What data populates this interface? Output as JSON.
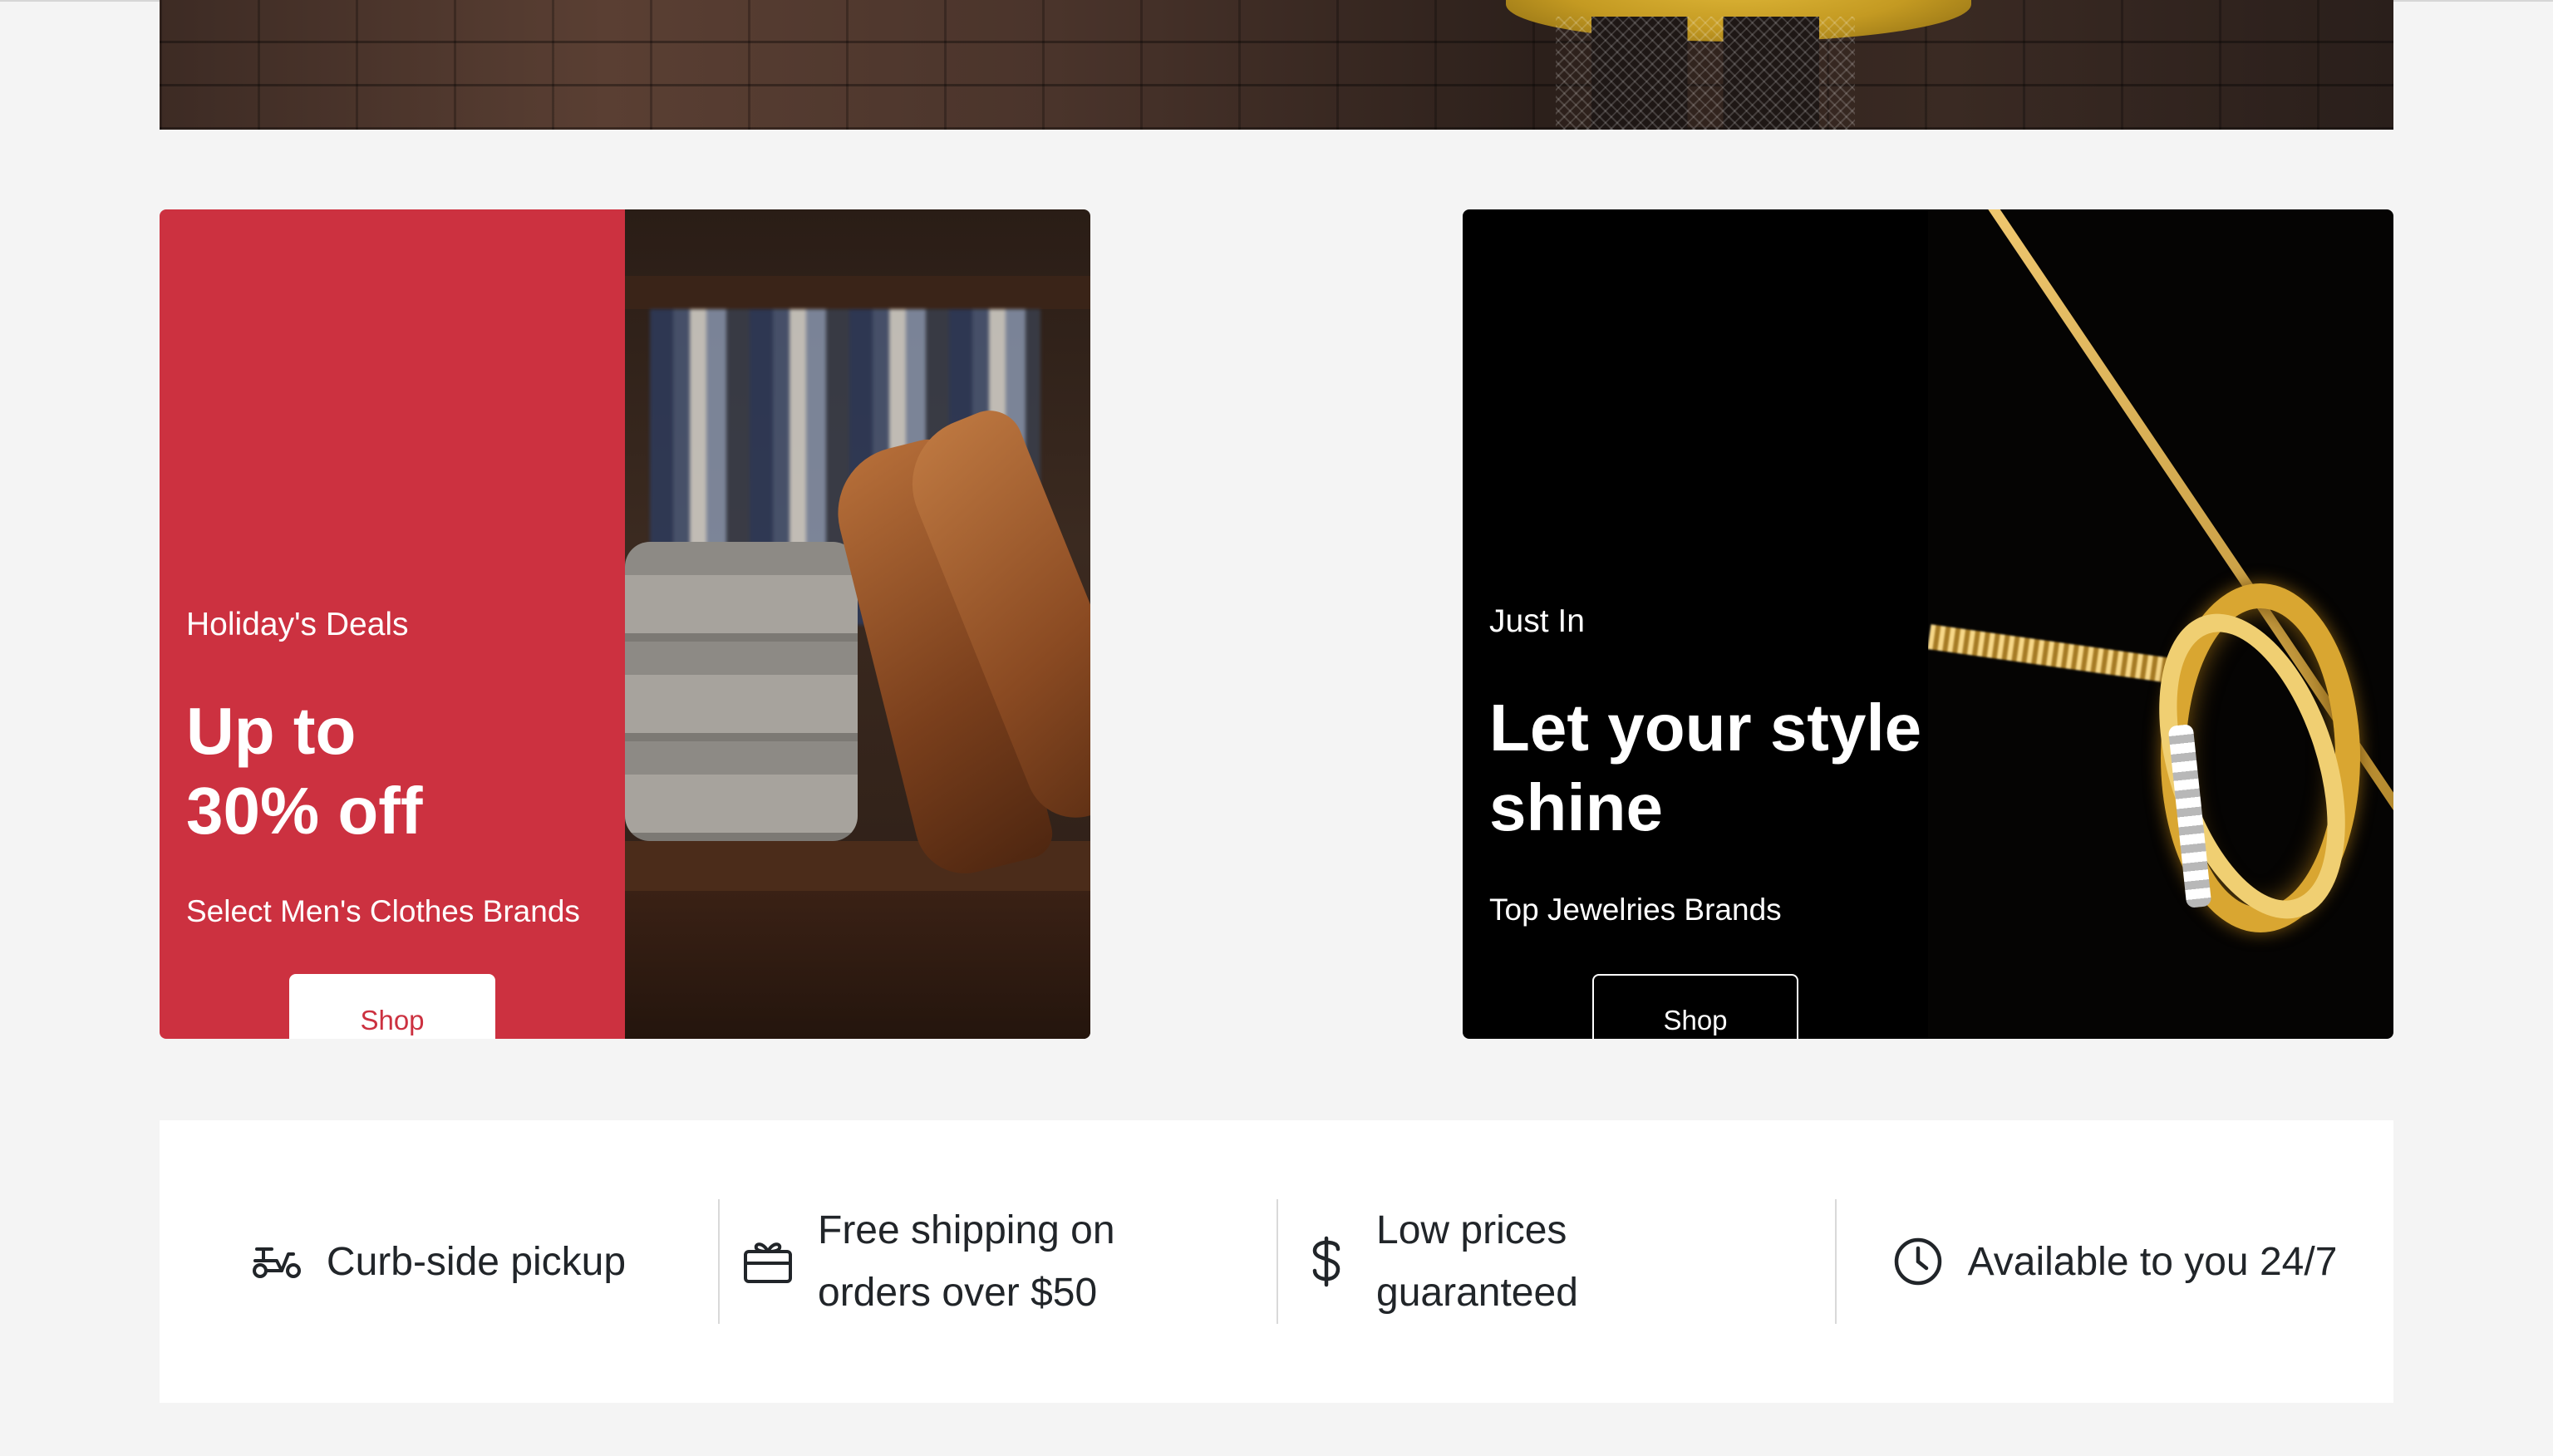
{
  "promos": [
    {
      "kicker": "Holiday's Deals",
      "headline_line1": "Up to",
      "headline_line2": "30% off",
      "subtitle": "Select Men's Clothes Brands",
      "button": "Shop",
      "image": "men-clothes-shoes",
      "accent": "#cc3140"
    },
    {
      "kicker": "Just In",
      "headline_line1": "Let your style",
      "headline_line2": "shine",
      "subtitle": "Top Jewelries Brands",
      "button": "Shop",
      "image": "gold-rings-necklace",
      "accent": "#000000"
    }
  ],
  "features": [
    {
      "icon": "scooter-icon",
      "label": "Curb-side pickup"
    },
    {
      "icon": "gift-card-icon",
      "label": "Free shipping on orders over $50"
    },
    {
      "icon": "dollar-icon",
      "label": "Low prices guaranteed"
    },
    {
      "icon": "clock-icon",
      "label": "Available to you 24/7"
    }
  ]
}
